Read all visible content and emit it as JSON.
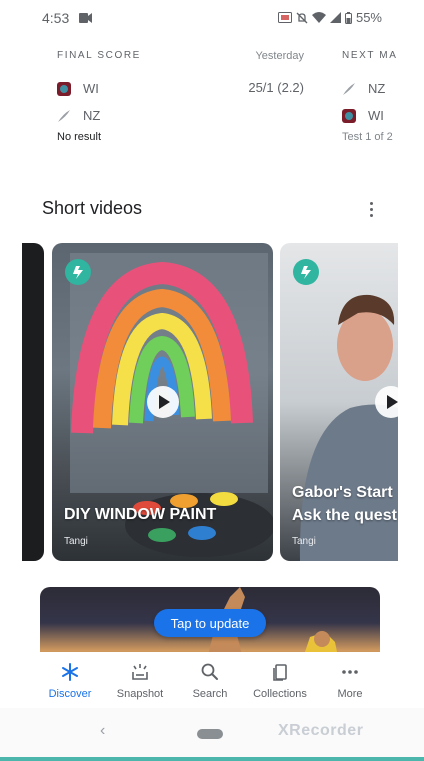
{
  "status": {
    "time": "4:53",
    "battery": "55%"
  },
  "score": {
    "final": {
      "heading": "FINAL SCORE",
      "team1": "WI",
      "team2": "NZ",
      "result": "No result"
    },
    "middle": {
      "day": "Yesterday",
      "score": "25/1 (2.2)",
      "series": "Test 1 of 2"
    },
    "next": {
      "heading": "NEXT MA",
      "team1": "NZ",
      "team2": "WI"
    }
  },
  "short_videos": {
    "title": "Short videos",
    "cards": [
      {
        "title": "DIY WINDOW PAINT",
        "source": "Tangi"
      },
      {
        "title_line1": "Gabor's Start",
        "title_line2": "Ask the quest",
        "source": "Tangi"
      }
    ]
  },
  "update_pill": "Tap to update",
  "nav": {
    "items": [
      {
        "label": "Discover",
        "icon": "asterisk-icon"
      },
      {
        "label": "Snapshot",
        "icon": "snapshot-icon"
      },
      {
        "label": "Search",
        "icon": "search-icon"
      },
      {
        "label": "Collections",
        "icon": "collections-icon"
      },
      {
        "label": "More",
        "icon": "more-dots-icon"
      }
    ],
    "active_color": "#1a73e8"
  },
  "watermark": "XRecorder"
}
